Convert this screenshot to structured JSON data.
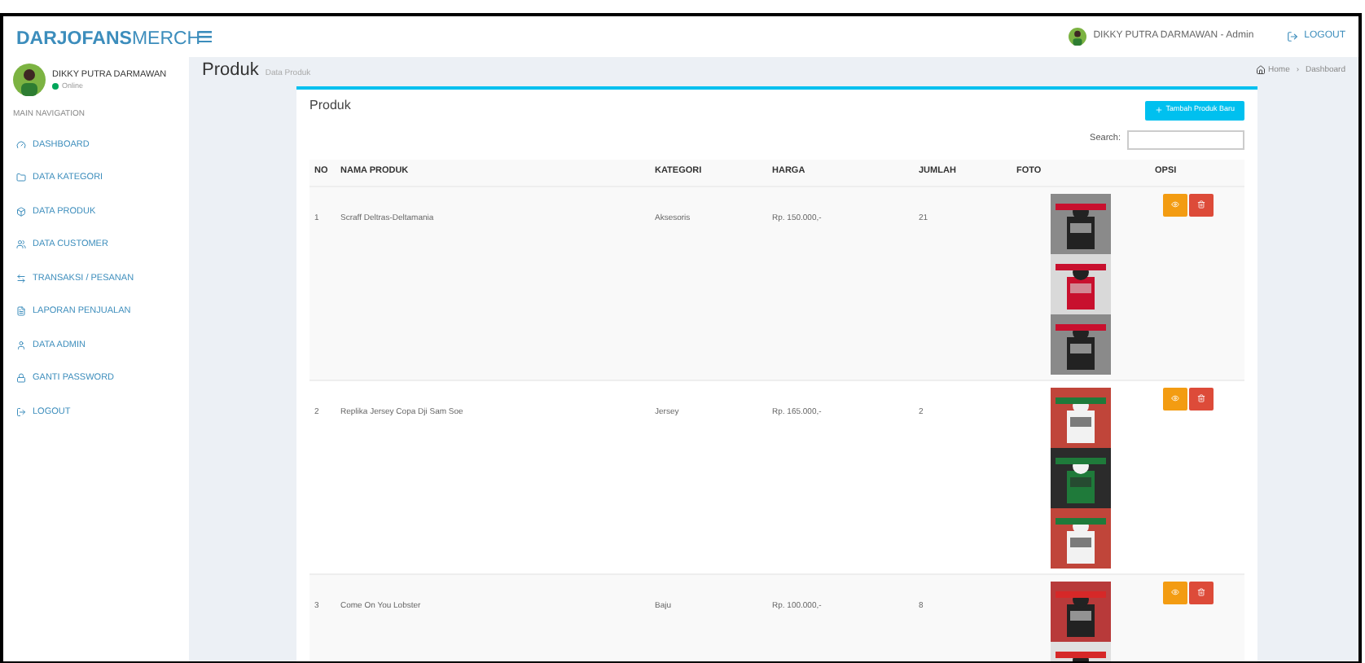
{
  "brand": {
    "bold": "DARJOFANS",
    "light": "MERCH"
  },
  "header": {
    "user": "DIKKY PUTRA DARMAWAN - Admin",
    "logout": "LOGOUT"
  },
  "sidebar": {
    "user": "DIKKY PUTRA DARMAWAN",
    "status": "Online",
    "section": "MAIN NAVIGATION",
    "items": [
      {
        "label": "DASHBOARD"
      },
      {
        "label": "DATA KATEGORI"
      },
      {
        "label": "DATA PRODUK"
      },
      {
        "label": "DATA CUSTOMER"
      },
      {
        "label": "TRANSAKSI / PESANAN"
      },
      {
        "label": "LAPORAN PENJUALAN"
      },
      {
        "label": "DATA ADMIN"
      },
      {
        "label": "GANTI PASSWORD"
      },
      {
        "label": "LOGOUT"
      }
    ]
  },
  "page": {
    "title": "Produk",
    "subtitle": "Data Produk",
    "breadcrumb": [
      "Home",
      "Dashboard"
    ],
    "breadcrumb_separator": "›"
  },
  "box": {
    "title": "Produk",
    "add_button": "Tambah Produk Baru",
    "search_label": "Search:"
  },
  "table": {
    "columns": [
      "NO",
      "NAMA PRODUK",
      "KATEGORI",
      "HARGA",
      "JUMLAH",
      "FOTO",
      "OPSI"
    ],
    "rows": [
      {
        "no": "1",
        "name": "Scraff Deltras-Deltamania",
        "category": "Aksesoris",
        "price": "Rp. 150.000,-",
        "qty": "21"
      },
      {
        "no": "2",
        "name": "Replika Jersey Copa Dji Sam Soe",
        "category": "Jersey",
        "price": "Rp. 165.000,-",
        "qty": "2"
      },
      {
        "no": "3",
        "name": "Come On You Lobster",
        "category": "Baju",
        "price": "Rp. 100.000,-",
        "qty": "8"
      }
    ]
  }
}
